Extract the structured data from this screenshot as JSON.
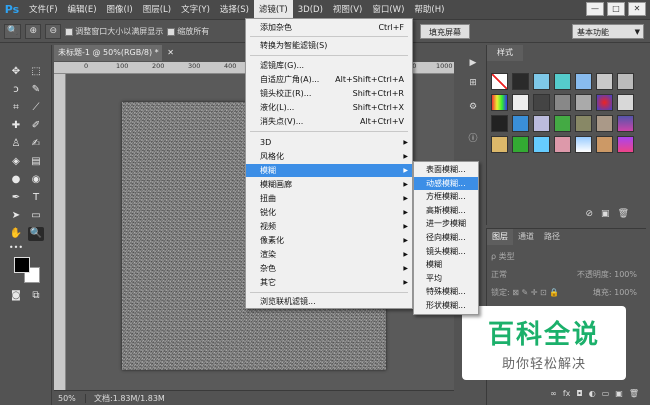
{
  "menubar": {
    "logo": "Ps",
    "items": [
      "文件(F)",
      "编辑(E)",
      "图像(I)",
      "图层(L)",
      "文字(Y)",
      "选择(S)",
      "滤镜(T)",
      "3D(D)",
      "视图(V)",
      "窗口(W)",
      "帮助(H)"
    ],
    "active_index": 6,
    "win_buttons": [
      "—",
      "□",
      "✕"
    ]
  },
  "options": {
    "tool_icon": "zoom-icon",
    "zoom_in": "⊕",
    "zoom_out": "⊖",
    "resize_label": "调整窗口大小以满屏显示",
    "zoom_all_label": "缩放所有",
    "fill_screen": "填充屏幕",
    "workspace": "基本功能"
  },
  "document": {
    "tab_title": "未标题-1 @ 50%(RGB/8) *",
    "tab_close": "✕",
    "ruler_labels": [
      "0",
      "100",
      "200",
      "300",
      "400",
      "500",
      "600",
      "700",
      "800",
      "900",
      "1000"
    ],
    "zoom": "50%",
    "doc_info": "文档:1.83M/1.83M"
  },
  "filter_menu": {
    "items": [
      {
        "label": "添加杂色",
        "shortcut": "Ctrl+F"
      },
      {
        "label": "转换为智能滤镜(S)"
      },
      {
        "label": "滤镜库(G)..."
      },
      {
        "label": "自适应广角(A)...",
        "shortcut": "Alt+Shift+Ctrl+A"
      },
      {
        "label": "镜头校正(R)...",
        "shortcut": "Shift+Ctrl+R"
      },
      {
        "label": "液化(L)...",
        "shortcut": "Shift+Ctrl+X"
      },
      {
        "label": "消失点(V)...",
        "shortcut": "Alt+Ctrl+V"
      },
      {
        "label": "3D"
      },
      {
        "label": "风格化"
      },
      {
        "label": "模糊"
      },
      {
        "label": "模糊画廊"
      },
      {
        "label": "扭曲"
      },
      {
        "label": "锐化"
      },
      {
        "label": "视频"
      },
      {
        "label": "像素化"
      },
      {
        "label": "渲染"
      },
      {
        "label": "杂色"
      },
      {
        "label": "其它"
      },
      {
        "label": "浏览联机滤镜..."
      }
    ],
    "arrow": "▶"
  },
  "blur_submenu": {
    "items": [
      "表面模糊...",
      "动感模糊...",
      "方框模糊...",
      "高斯模糊...",
      "进一步模糊",
      "径向模糊...",
      "镜头模糊...",
      "模糊",
      "平均",
      "特殊模糊...",
      "形状模糊..."
    ],
    "highlight_index": 1
  },
  "styles_panel": {
    "tab": "样式",
    "footer_icons": [
      "⊘",
      "▣",
      "🗑"
    ]
  },
  "layers_panel": {
    "tabs": [
      "图层",
      "通道",
      "路径"
    ],
    "filter_label": "ρ 类型",
    "mode_label": "正常",
    "opacity_label": "不透明度: 100%",
    "lock_label": "锁定: ⊠ ✎ ✛ ⊡ 🔒",
    "fill_label": "填充: 100%",
    "footer_icons": [
      "∞",
      "fx",
      "◘",
      "◐",
      "▭",
      "▣",
      "🗑"
    ]
  },
  "watermark": {
    "title": "百科全说",
    "subtitle": "助你轻松解决"
  },
  "colors": {
    "accent": "#3c8ee6",
    "watermark_green": "#1bb06b"
  }
}
